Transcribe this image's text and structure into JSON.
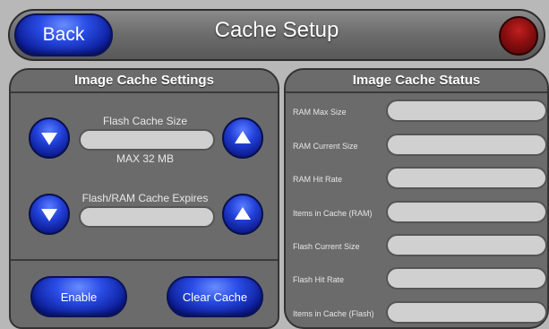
{
  "header": {
    "title": "Cache Setup",
    "back_label": "Back"
  },
  "left_panel": {
    "title": "Image Cache Settings",
    "flash_cache_size_label": "Flash Cache Size",
    "flash_cache_size_value": "",
    "max_note": "MAX  32 MB",
    "expires_label": "Flash/RAM Cache Expires",
    "expires_value": "",
    "enable_label": "Enable",
    "clear_cache_label": "Clear Cache"
  },
  "right_panel": {
    "title": "Image Cache Status",
    "rows": [
      {
        "label": "RAM Max Size",
        "value": ""
      },
      {
        "label": "RAM Current Size",
        "value": ""
      },
      {
        "label": "RAM Hit Rate",
        "value": ""
      },
      {
        "label": "Items in Cache (RAM)",
        "value": ""
      },
      {
        "label": "Flash Current Size",
        "value": ""
      },
      {
        "label": "Flash Hit Rate",
        "value": ""
      },
      {
        "label": "Items in Cache (Flash)",
        "value": ""
      }
    ]
  },
  "colors": {
    "accent_blue": "#2240d8",
    "status_red": "#8b0f10",
    "panel_gray": "#6b6b6b"
  },
  "icons": {
    "decrease": "down-triangle-icon",
    "increase": "up-triangle-icon",
    "status": "status-light-icon"
  }
}
